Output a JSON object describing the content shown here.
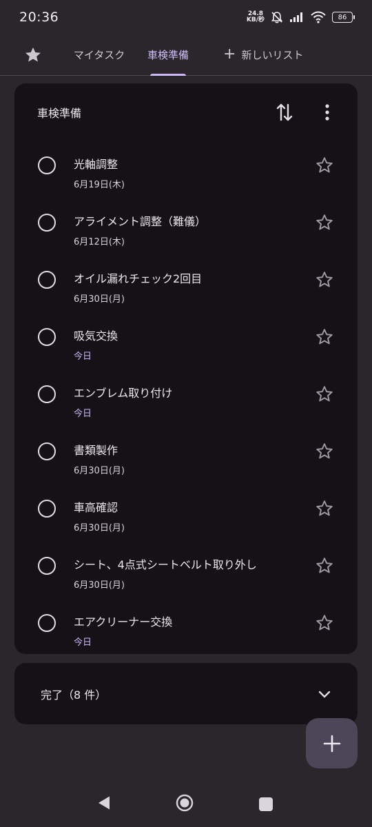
{
  "status_bar": {
    "time": "20:36",
    "net_speed_value": "24.8",
    "net_speed_unit": "KB/秒",
    "battery": "86"
  },
  "tabs": {
    "starred_icon": "star-icon",
    "items": [
      {
        "label": "マイタスク"
      },
      {
        "label": "車検準備",
        "active": true
      },
      {
        "label": "新しいリスト"
      }
    ]
  },
  "list": {
    "title": "車検準備",
    "tasks": [
      {
        "title": "光軸調整",
        "date": "6月19日(木)",
        "today": false
      },
      {
        "title": "アライメント調整（難儀）",
        "date": "6月12日(木)",
        "today": false
      },
      {
        "title": "オイル漏れチェック2回目",
        "date": "6月30日(月)",
        "today": false
      },
      {
        "title": "吸気交換",
        "date": "今日",
        "today": true
      },
      {
        "title": "エンブレム取り付け",
        "date": "今日",
        "today": true
      },
      {
        "title": "書類製作",
        "date": "6月30日(月)",
        "today": false
      },
      {
        "title": "車高確認",
        "date": "6月30日(月)",
        "today": false
      },
      {
        "title": "シート、4点式シートベルト取り外し",
        "date": "6月30日(月)",
        "today": false
      },
      {
        "title": "エアクリーナー交換",
        "date": "今日",
        "today": true
      }
    ]
  },
  "completed": {
    "label": "完了（8 件）"
  },
  "colors": {
    "accent": "#cdb6f8",
    "card_bg": "#141217",
    "page_bg": "#29272b",
    "fab_bg": "#4d4558"
  }
}
